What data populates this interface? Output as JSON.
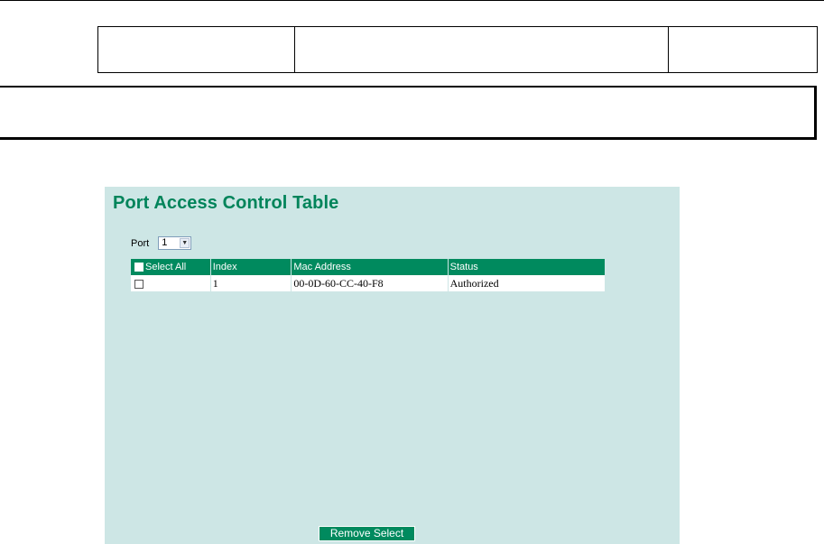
{
  "panel": {
    "title": "Port Access Control Table",
    "port_label": "Port",
    "port_value": "1"
  },
  "table": {
    "headers": [
      "Select All",
      "Index",
      "Mac Address",
      "Status"
    ],
    "rows": [
      {
        "index": "1",
        "mac": "00-0D-60-CC-40-F8",
        "status": "Authorized"
      }
    ]
  },
  "actions": {
    "remove_label": "Remove Select"
  },
  "colors": {
    "accent": "#008a5e",
    "panel_bg": "#cde6e5",
    "title": "#00845a"
  }
}
